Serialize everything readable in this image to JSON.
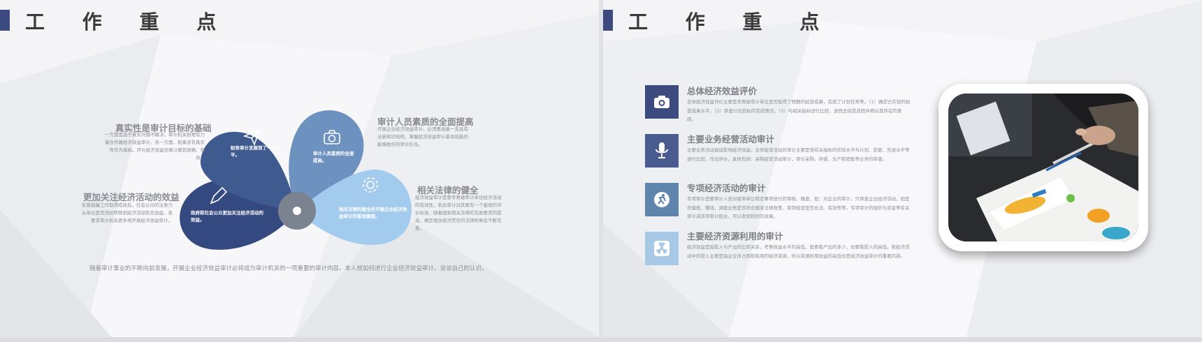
{
  "left": {
    "title": "工 作 重 点",
    "blocks": [
      {
        "heading": "真实性是审计目标的基础",
        "text": "一方面是由于真实问题不解决，审计机关很难有力量合作履经济效益审计。另一方面，如果没有真实性作为基础，评价经济效益也难以做到准确、有效。"
      },
      {
        "heading": "更加关注经济活动的效益",
        "text": "反腐倡廉工作取得成效后，社会公众的注意力从单位是否违纪转移到经济活动有无效益，各要求审计机关更多地开展经济效益审计。"
      },
      {
        "heading": "审计人员素质的全面提高",
        "text": "开展企业经济效益审计，必须要具备一支具有全新知识结构、掌握经济效益审计基本技能的能够胜任的审计队伍。"
      },
      {
        "heading": "相关法律的健全",
        "text": "经济效益审计是要考察被审计单位经济活动的有效性，若此审计对其要有一个客观的评价标准，随着国家相关法律的完善要求的提高，确定相关经济责任的法律规章会不断完善。"
      }
    ],
    "petals": [
      {
        "text": "财务审计发展到了一定水平。",
        "icon": "paper-plane-icon"
      },
      {
        "text": "审计人员素质的全面提高。",
        "icon": "camera-icon"
      },
      {
        "text": "相关法律的健全并开展企业经济效益审计的客观需要。",
        "icon": "gear-icon"
      },
      {
        "text": "政府和社会公众更加关注经济活动的效益。",
        "icon": "pencil-icon"
      }
    ],
    "footer": "随着审计事业的不断向前发展，开展企业经济效益审计必将成为审计机关的一项重要的审计内容。本人就如何进行企业经济效益审计，谈谈自己的认识。"
  },
  "right": {
    "title": "工 作 重 点",
    "items": [
      {
        "title": "总体经济效益评价",
        "text": "总体经济效益评价主要是考察被审计单位是否取得了预期的经营成果，完成了计划任务等。（1）确定已实现的经营成果水平，（2）审查计划目标的完成情况，（3）与相关指标进行比较，进而总结其成绩并揭示其存在的差距。",
        "icon": "camera-icon",
        "color": "#3c4a7f"
      },
      {
        "title": "主要业务经营活动审计",
        "text": "主要业务活动直接影响经济效益，业务经营活动的审计主要是将有关指标的实际水平与计划、定额、先进水平等进行比较，作出评价，具体包括：采购经营活动审计，审计采购、存储、生产和销售等业务的审查。",
        "icon": "microphone-icon",
        "color": "#4a5c8f"
      },
      {
        "title": "专项经济活动的审计",
        "text": "专项审计是要审计人员对被审单位特定事项进行的审核、稽查，如：对企业的审计，只审查企业经济活动，如是否偏低、赚钱、调查业务是否符合国家法律政策，某项经营是否合法、有效等等。专项审计的组织与资金等有关审计或该项审计配合，可以收到较好的效果。",
        "icon": "running-icon",
        "color": "#5f85ad"
      },
      {
        "title": "主要经济资源利用的审计",
        "text": "经济效益是指投入与产出的比较关系，考察效益水平的高低，既要看产出的多少，也要看投入的高低。若经济活动中的投入主要是指企业所占用和耗用的经济资源，所以资源利用效益的高低也是经济效益审计的重要内容。",
        "icon": "radiation-icon",
        "color": "#a8c9e6"
      }
    ],
    "photo": "business-chart-photo"
  },
  "colors": {
    "petal1": "#3f5a8e",
    "petal2": "#6d92bf",
    "petal3": "#a3cbee",
    "petal4": "#34497f",
    "center": "#7b8290",
    "accent": "#3c4a7f"
  }
}
